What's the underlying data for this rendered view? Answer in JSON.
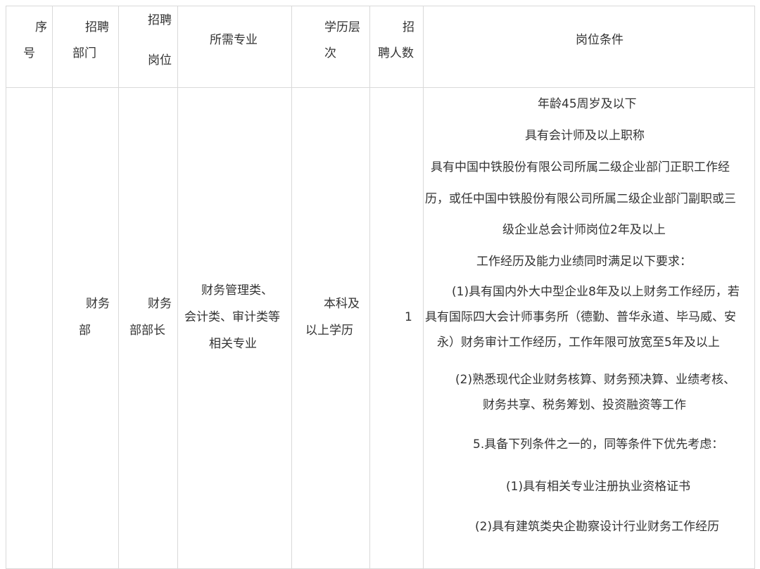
{
  "header": {
    "seq": [
      "序",
      "号"
    ],
    "dept": [
      "招聘",
      "部门"
    ],
    "post": [
      "招聘",
      "岗位"
    ],
    "major": "所需专业",
    "edu": [
      "学历层",
      "次"
    ],
    "count": [
      "招",
      "聘人数"
    ],
    "conditions": "岗位条件"
  },
  "row": {
    "dept": [
      "财务",
      "部"
    ],
    "post": [
      "财务",
      "部部长"
    ],
    "major": [
      "财务管理类、",
      "会计类、审计类等",
      "相关专业"
    ],
    "edu": [
      "本科及",
      "以上学历"
    ],
    "count": "1",
    "conditions": [
      "年龄45周岁及以下",
      "具有会计师及以上职称",
      "具有中国中铁股份有限公司所属二级企业部门正职工作经",
      "历，或任中国中铁股份有限公司所属二级企业部门副职或三",
      "级企业总会计师岗位2年及以上",
      "工作经历及能力业绩同时满足以下要求：",
      "(1)具有国内外大中型企业8年及以上财务工作经历，若",
      "具有国际四大会计师事务所（德勤、普华永道、毕马威、安",
      "永）财务审计工作经历，工作年限可放宽至5年及以上",
      "(2)熟悉现代企业财务核算、财务预决算、业绩考核、",
      "财务共享、税务筹划、投资融资等工作",
      "5.具备下列条件之一的，同等条件下优先考虑：",
      "(1)具有相关专业注册执业资格证书",
      "(2)具有建筑类央企勘察设计行业财务工作经历"
    ]
  }
}
